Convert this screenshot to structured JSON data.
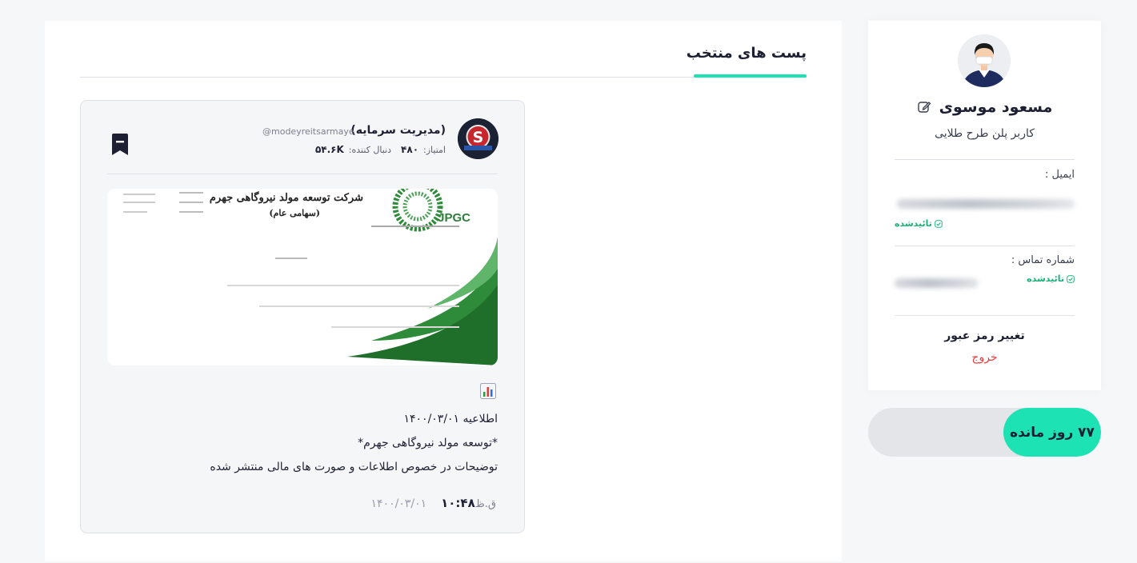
{
  "sidebar": {
    "user_name": "مسعود موسوی",
    "plan": "کاربر پلن طرح طلایی",
    "email_label": "ایمیل :",
    "email_status": "تائیدشده",
    "phone_label": "شماره تماس :",
    "phone_status": "تائیدشده",
    "change_password": "تغییر رمز عبور",
    "logout": "خروج",
    "days_remaining": "۷۷ روز مانده"
  },
  "main": {
    "section_title": "پست های منتخب",
    "post": {
      "author_name": "(مدیریت سرمایه)",
      "author_handle": "@modeyreitsarmaye",
      "score_label": "امتیاز:",
      "score_value": "۴۸۰",
      "followers_label": "دنبال کننده:",
      "followers_value": "۵۴.۶K",
      "image_doc": {
        "company": "شرکت توسعه مولد نیروگاهی جهرم",
        "company_sub": "(سهامی عام)",
        "logo": "JPGC"
      },
      "text_lines": [
        "اطلاعیه ۱۴۰۰/۰۳/۰۱",
        "*توسعه مولد نیروگاهی جهرم*",
        "توضیحات در خصوص اطلاعات و صورت های مالی منتشر شده"
      ],
      "time": "۱۰:۴۸",
      "time_suffix": "ق.ظ",
      "date": "۱۴۰۰/۰۳/۰۱"
    }
  },
  "colors": {
    "accent": "#1de2b4",
    "verified": "#1cb07a",
    "logout": "#e93c3c",
    "bookmark": "#1d2033"
  },
  "icons": [
    "edit-icon",
    "verified-check-icon",
    "bookmark-icon",
    "bar-chart-emoji-icon"
  ]
}
